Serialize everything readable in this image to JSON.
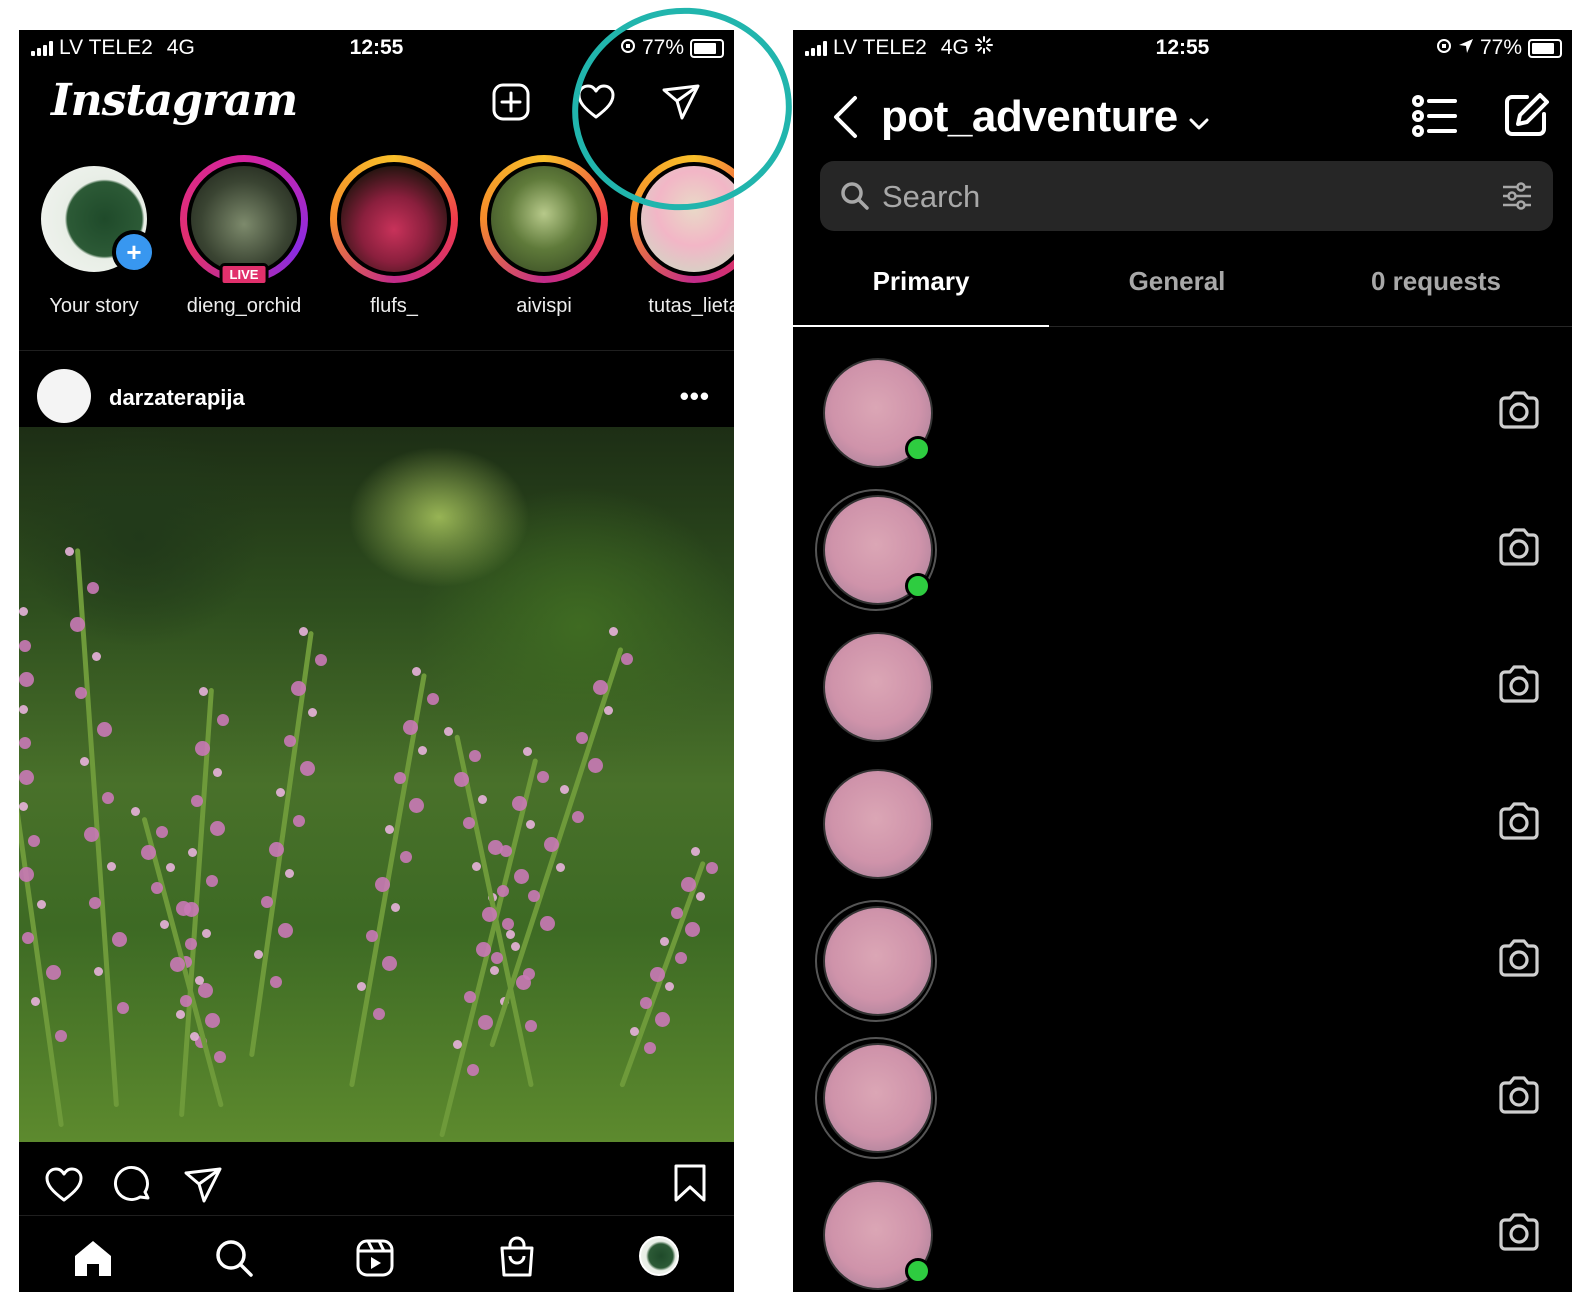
{
  "left_screen": {
    "status": {
      "carrier": "LV TELE2",
      "network": "4G",
      "time": "12:55",
      "battery": "77%"
    },
    "logo": "Instagram",
    "stories": [
      {
        "name": "Your story"
      },
      {
        "name": "dieng_orchid",
        "badge": "LIVE"
      },
      {
        "name": "flufs_"
      },
      {
        "name": "aivispi"
      },
      {
        "name": "tutas_lieta"
      }
    ],
    "post": {
      "username": "darzaterapija",
      "more": "•••"
    },
    "icons": [
      "new-post-icon",
      "heart-icon",
      "direct-message-icon",
      "like-icon",
      "comment-icon",
      "share-icon",
      "save-icon",
      "home-icon",
      "search-icon",
      "reels-icon",
      "shop-icon",
      "profile-icon"
    ]
  },
  "right_screen": {
    "status": {
      "carrier": "LV TELE2",
      "network": "4G",
      "time": "12:55",
      "battery": "77%"
    },
    "account": "pot_adventure",
    "search_placeholder": "Search",
    "tabs": [
      {
        "label": "Primary",
        "active": true
      },
      {
        "label": "General",
        "active": false
      },
      {
        "label": "0 requests",
        "active": false
      }
    ],
    "conversations": [
      {
        "online": true,
        "story_ring": false
      },
      {
        "online": true,
        "story_ring": true
      },
      {
        "online": false,
        "story_ring": false
      },
      {
        "online": false,
        "story_ring": false
      },
      {
        "online": false,
        "story_ring": true
      },
      {
        "online": false,
        "story_ring": true
      },
      {
        "online": true,
        "story_ring": false
      }
    ]
  },
  "colors": {
    "annotation": "#21b5ad",
    "live": "#e1306c",
    "online": "#2ecc40",
    "accent": "#3897f0"
  }
}
